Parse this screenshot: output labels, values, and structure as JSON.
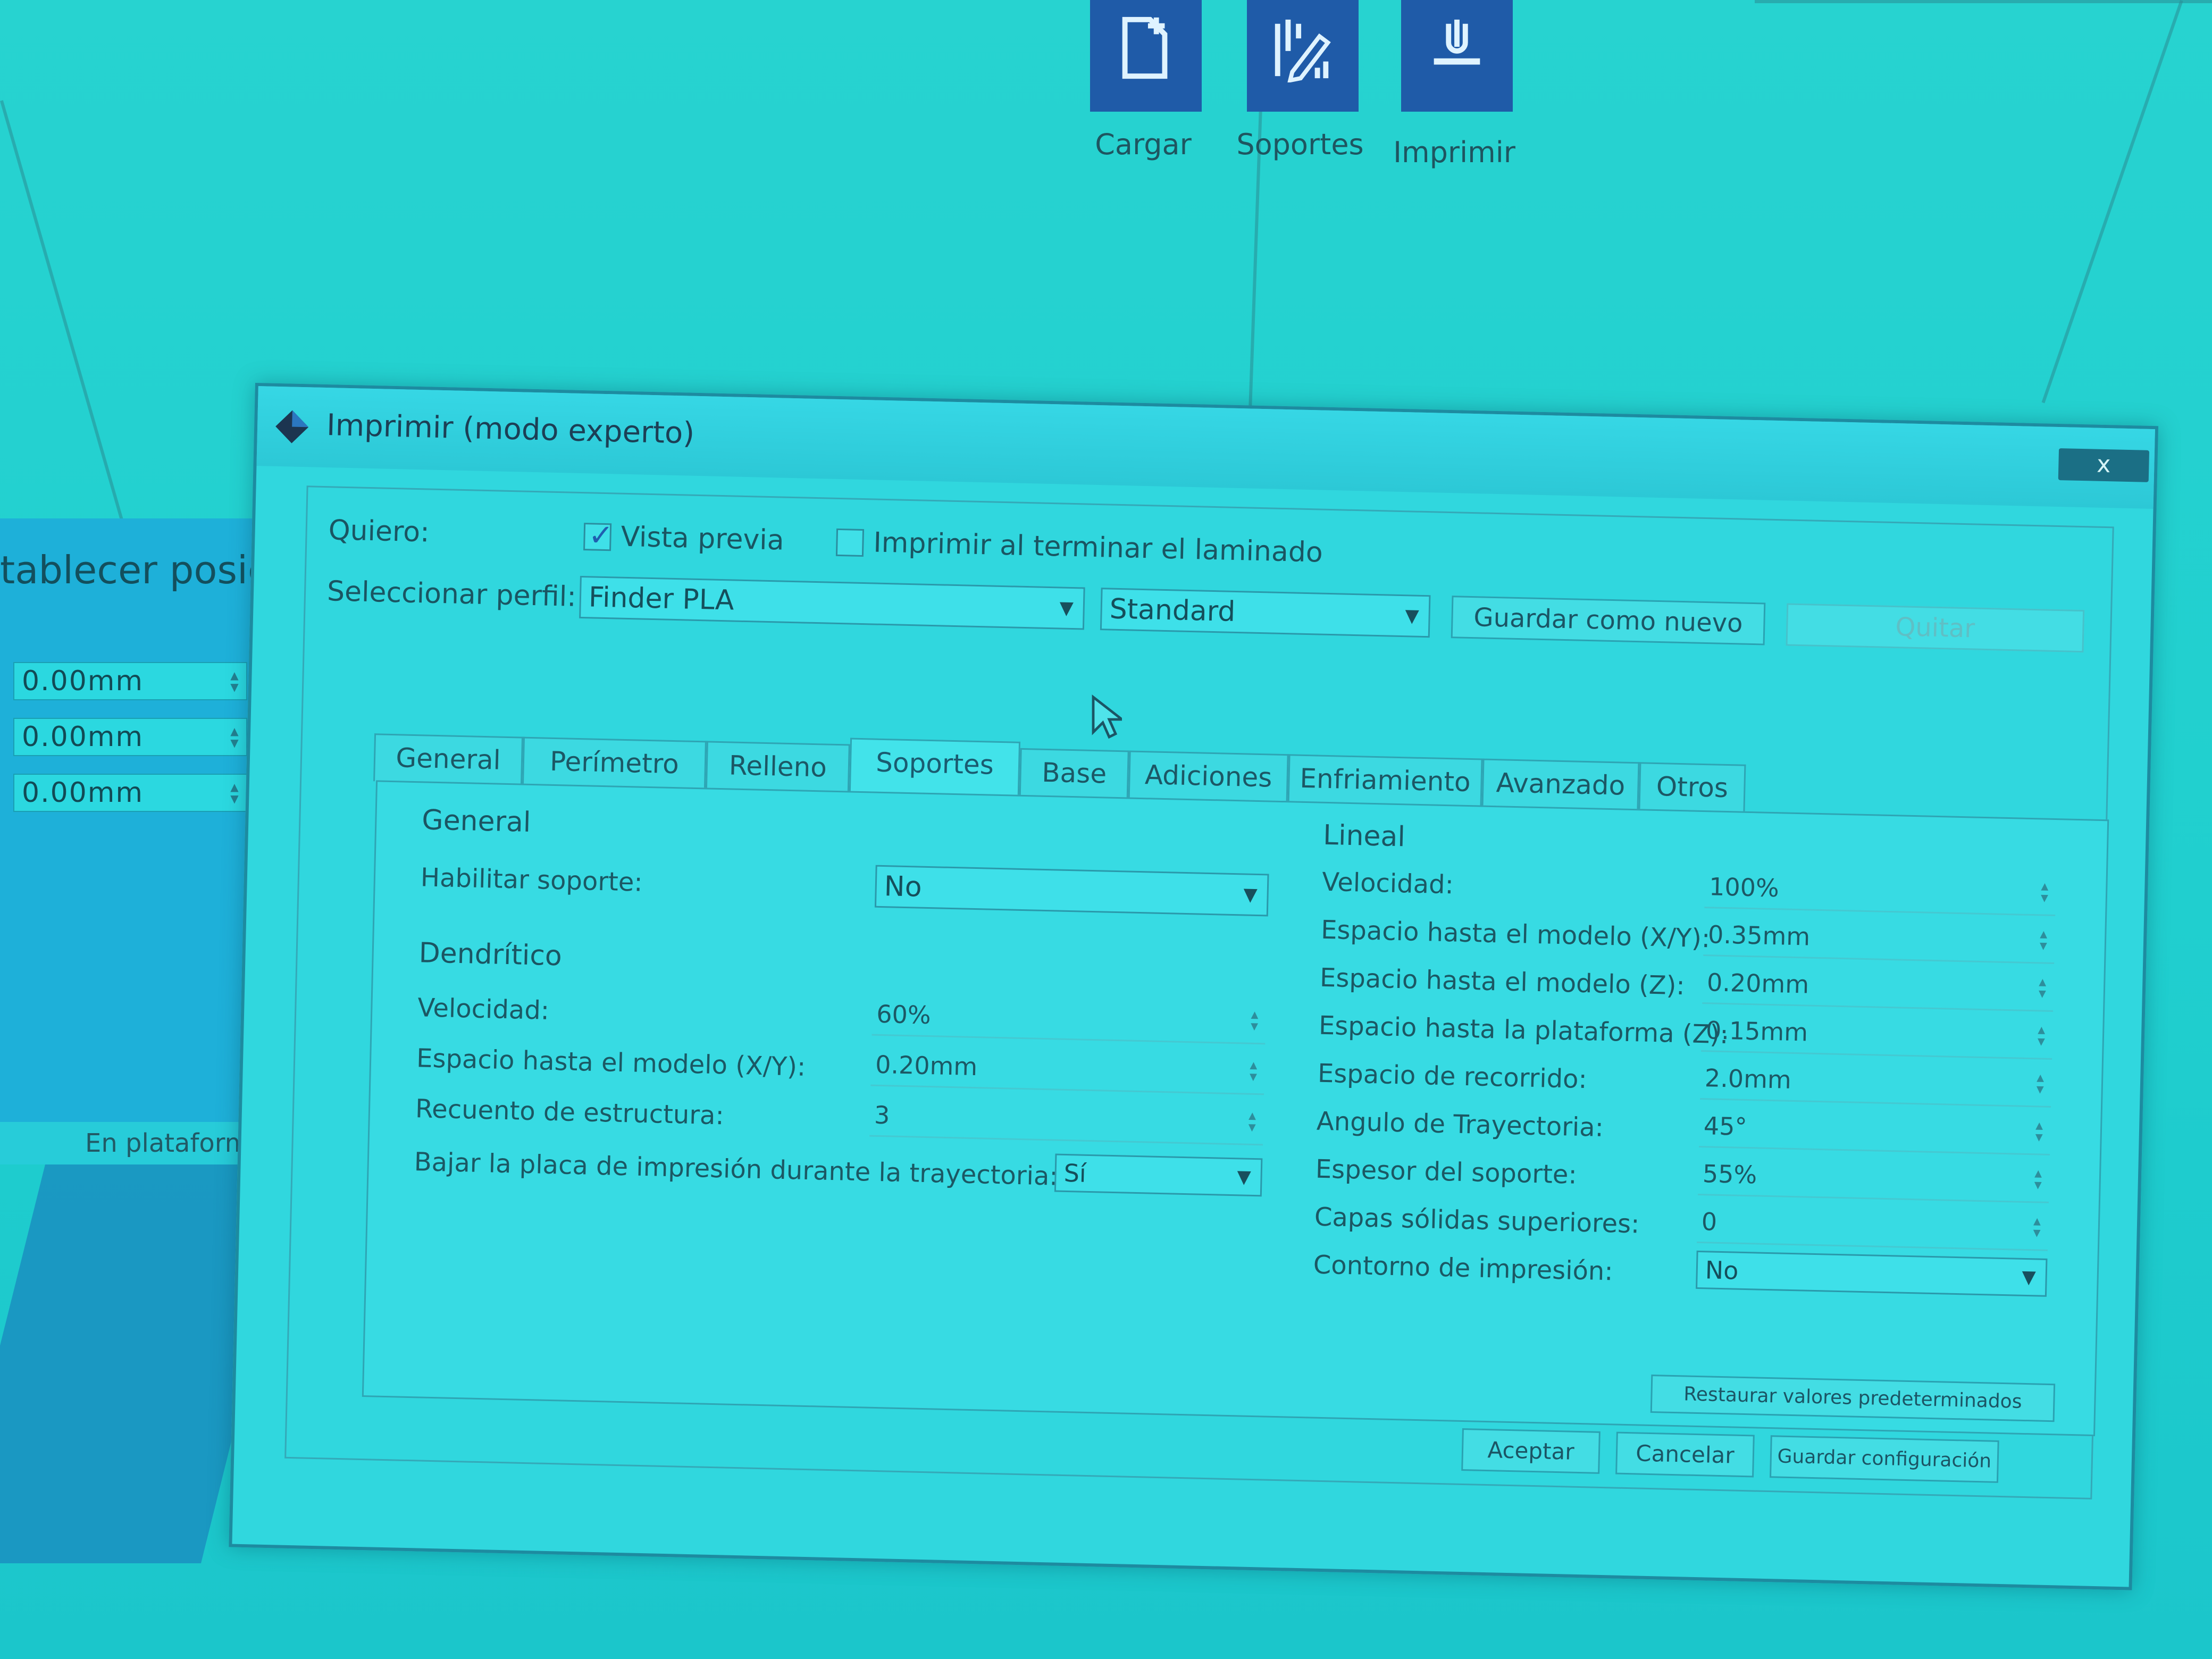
{
  "toolbar": {
    "buttons": [
      {
        "label": "Cargar",
        "icon": "load-file-icon"
      },
      {
        "label": "Soportes",
        "icon": "supports-icon"
      },
      {
        "label": "Imprimir",
        "icon": "print-icon"
      }
    ]
  },
  "left_panel": {
    "title": "tablecer posici",
    "fields": [
      "0.00mm",
      "0.00mm",
      "0.00mm"
    ],
    "footer": "En plataforma"
  },
  "dialog": {
    "title": "Imprimir (modo experto)",
    "close_label": "x",
    "quiero_label": "Quiero:",
    "preview_label": "Vista previa",
    "preview_checked": true,
    "print_after_label": "Imprimir al terminar el laminado",
    "print_after_checked": false,
    "profile_label": "Seleccionar perfil:",
    "profile_value": "Finder PLA",
    "quality_value": "Standard",
    "save_new_label": "Guardar como nuevo",
    "remove_label": "Quitar",
    "tabs": [
      "General",
      "Perímetro",
      "Relleno",
      "Soportes",
      "Base",
      "Adiciones",
      "Enfriamiento",
      "Avanzado",
      "Otros"
    ],
    "active_tab": "Soportes",
    "left": {
      "general_title": "General",
      "enable_label": "Habilitar soporte:",
      "enable_value": "No",
      "dendritic_title": "Dendrítico",
      "speed_label": "Velocidad:",
      "speed_value": "60%",
      "xy_gap_label": "Espacio hasta el modelo (X/Y):",
      "xy_gap_value": "0.20mm",
      "structure_label": "Recuento de estructura:",
      "structure_value": "3",
      "lower_label": "Bajar la placa de impresión durante la trayectoria:",
      "lower_value": "Sí"
    },
    "right": {
      "linear_title": "Lineal",
      "rows": [
        {
          "label": "Velocidad:",
          "value": "100%",
          "type": "spin"
        },
        {
          "label": "Espacio hasta el modelo (X/Y):",
          "value": "0.35mm",
          "type": "spin"
        },
        {
          "label": "Espacio hasta el modelo (Z):",
          "value": "0.20mm",
          "type": "spin"
        },
        {
          "label": "Espacio hasta la plataforma (Z):",
          "value": "0.15mm",
          "type": "spin"
        },
        {
          "label": "Espacio de recorrido:",
          "value": "2.0mm",
          "type": "spin"
        },
        {
          "label": "Angulo de Trayectoria:",
          "value": "45°",
          "type": "spin"
        },
        {
          "label": "Espesor del soporte:",
          "value": "55%",
          "type": "spin"
        },
        {
          "label": "Capas sólidas superiores:",
          "value": "0",
          "type": "spin"
        },
        {
          "label": "Contorno de impresión:",
          "value": "No",
          "type": "combo"
        }
      ]
    },
    "restore_label": "Restaurar valores predeterminados",
    "accept_label": "Aceptar",
    "cancel_label": "Cancelar",
    "save_config_label": "Guardar configuración"
  }
}
